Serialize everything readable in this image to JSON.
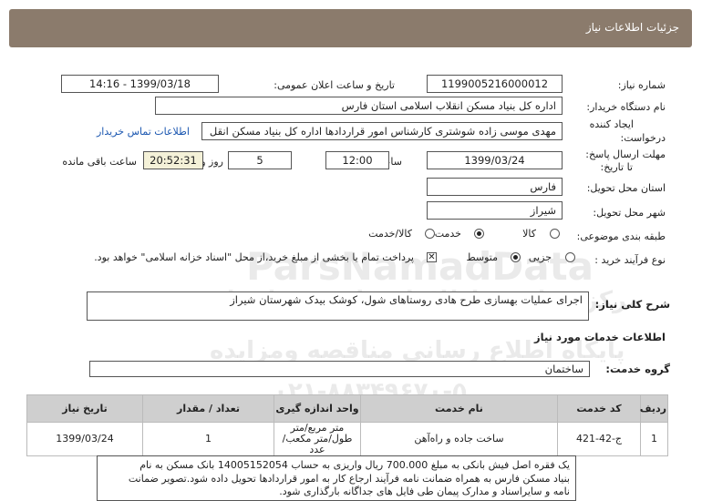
{
  "header": {
    "title": "جزئیات اطلاعات نیاز"
  },
  "need_number": {
    "label": "شماره نیاز:",
    "value": "1199005216000012"
  },
  "announce": {
    "label": "تاریخ و ساعت اعلان عمومی:",
    "value": "1399/03/18 - 14:16"
  },
  "buyer": {
    "label": "نام دستگاه خریدار:",
    "value": "اداره کل بنیاد مسکن انقلاب اسلامی استان فارس"
  },
  "creator": {
    "label_line1": "ایجاد کننده",
    "label_line2": "درخواست:",
    "value": "مهدی موسی زاده شوشتری کارشناس امور قراردادها اداره کل بنیاد مسکن انقل",
    "contact_link": "اطلاعات تماس خریدار"
  },
  "deadline": {
    "label_line1": "مهلت ارسال پاسخ:",
    "label_line2": "تا تاریخ:",
    "date": "1399/03/24",
    "time_label": "ساعت",
    "time": "12:00",
    "days": "5",
    "days_label": "روز و",
    "remaining": "20:52:31",
    "remaining_label": "ساعت باقی مانده"
  },
  "province": {
    "label": "استان محل تحویل:",
    "value": "فارس"
  },
  "city": {
    "label": "شهر محل تحویل:",
    "value": "شیراز"
  },
  "category": {
    "label": "طبقه بندی موضوعی:",
    "options": [
      "کالا",
      "خدمت",
      "کالا/خدمت"
    ],
    "selected": "خدمت"
  },
  "process": {
    "label": "نوع فرآیند خرید :",
    "options": [
      "جزیی",
      "متوسط"
    ],
    "selected": "متوسط",
    "payment_note": "پرداخت تمام یا بخشی از مبلغ خرید،از محل \"اسناد خزانه اسلامی\" خواهد بود."
  },
  "summary": {
    "label": "شرح کلی نیاز:",
    "value": "اجرای عملیات بهسازی طرح هادی روستاهای شول، کوشک بیدک شهرستان شیراز"
  },
  "services_title": "اطلاعات خدمات مورد نیاز",
  "service_group": {
    "label": "گروه خدمت:",
    "value": "ساختمان"
  },
  "table": {
    "headers": [
      "ردیف",
      "کد خدمت",
      "نام خدمت",
      "واحد اندازه گیری",
      "تعداد / مقدار",
      "تاریخ نیاز"
    ],
    "rows": [
      {
        "row": "1",
        "code": "ج-42-421",
        "name": "ساخت جاده و راه‌آهن",
        "unit_line1": "متر مربع/متر",
        "unit_line2": "طول/متر مکعب/عدد",
        "qty": "1",
        "date": "1399/03/24"
      }
    ]
  },
  "notes": {
    "line1": "یک فقره اصل فیش بانکی به مبلغ 700.000 ریال واریزی به حساب 14005152054 بانک مسکن به نام",
    "line2": "بنیاد مسکن فارس به همراه ضمانت نامه فرآیند ارجاع کار به امور قراردادها تحویل داده شود.تصویر ضمانت",
    "line3": "نامه و سایراسناد و مدارک پیمان طی فایل های جداگانه بارگذاری شود."
  },
  "watermark": {
    "main": "ParsNamadData",
    "sub1": "مرکز فراوری اطلاعات پارس نماد داده",
    "sub2": "پایگاه اطلاع رسانی مناقصه ومزایده",
    "phone": "۰۲۱-۸۸۳۴۹۶۷۰-۵"
  }
}
